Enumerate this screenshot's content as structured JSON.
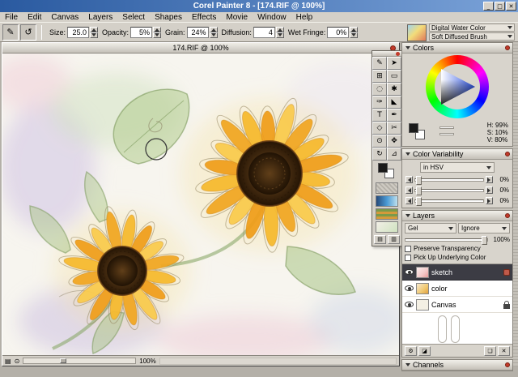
{
  "window": {
    "title": "Corel Painter 8 - [174.RIF @ 100%]",
    "controls": {
      "minimize": "_",
      "maximize": "□",
      "close": "✕"
    }
  },
  "menu": {
    "items": [
      "File",
      "Edit",
      "Canvas",
      "Layers",
      "Select",
      "Shapes",
      "Effects",
      "Movie",
      "Window",
      "Help"
    ]
  },
  "property_bar": {
    "brush_tool_glyph": "✎",
    "reset_glyph": "↺",
    "fields": [
      {
        "name": "size-field",
        "label": "Size:",
        "value": "25.0"
      },
      {
        "name": "opacity-field",
        "label": "Opacity:",
        "value": "5%"
      },
      {
        "name": "grain-field",
        "label": "Grain:",
        "value": "24%"
      },
      {
        "name": "diffusion-field",
        "label": "Diffusion:",
        "value": "4"
      },
      {
        "name": "wet-fringe-field",
        "label": "Wet Fringe:",
        "value": "0%"
      }
    ],
    "brush_selector": {
      "category": "Digital Water Color",
      "variant": "Soft Diffused Brush"
    }
  },
  "document": {
    "title": "174.RIF @ 100%",
    "zoom": "100%"
  },
  "toolbox": {
    "tools": [
      {
        "name": "brush-tool",
        "glyph": "✎"
      },
      {
        "name": "layer-adjuster-tool",
        "glyph": "➤"
      },
      {
        "name": "crop-tool",
        "glyph": "⊞"
      },
      {
        "name": "rect-select-tool",
        "glyph": "▭"
      },
      {
        "name": "lasso-tool",
        "glyph": "◌"
      },
      {
        "name": "magic-wand-tool",
        "glyph": "✱"
      },
      {
        "name": "dropper-tool",
        "glyph": "✑"
      },
      {
        "name": "paint-bucket-tool",
        "glyph": "◣"
      },
      {
        "name": "text-tool",
        "glyph": "T"
      },
      {
        "name": "pen-tool",
        "glyph": "✒"
      },
      {
        "name": "shape-tool",
        "glyph": "◇"
      },
      {
        "name": "scissors-tool",
        "glyph": "✂"
      },
      {
        "name": "magnifier-tool",
        "glyph": "⊙"
      },
      {
        "name": "grabber-tool",
        "glyph": "✥"
      },
      {
        "name": "rotate-page-tool",
        "glyph": "↻"
      },
      {
        "name": "perspective-grid-tool",
        "glyph": "⊿"
      }
    ]
  },
  "palettes": {
    "colors": {
      "title": "Colors",
      "hsv": [
        "H: 99%",
        "S: 10%",
        "V: 80%"
      ]
    },
    "variability": {
      "title": "Color Variability",
      "mode": "in HSV",
      "sliders": [
        "0%",
        "0%",
        "0%"
      ]
    },
    "layers": {
      "title": "Layers",
      "composite_method": "Gel",
      "composite_depth": "Ignore",
      "opacity": "100%",
      "checkboxes": [
        "Preserve Transparency",
        "Pick Up Underlying Color"
      ],
      "rows": [
        {
          "name": "sketch",
          "selected": true,
          "badge": true
        },
        {
          "name": "color",
          "selected": false,
          "badge": false
        },
        {
          "name": "Canvas",
          "selected": false,
          "locked": true
        }
      ],
      "buttons": [
        {
          "name": "dynamic-plugins-button",
          "glyph": "⚙"
        },
        {
          "name": "new-channel-button",
          "glyph": "◪"
        },
        {
          "name": "new-layer-button",
          "glyph": "❏"
        },
        {
          "name": "delete-layer-button",
          "glyph": "✕"
        }
      ]
    },
    "channels": {
      "title": "Channels"
    }
  },
  "statusbar": {
    "drawer_glyph": "▤",
    "magnifier_glyph": "⊙"
  }
}
